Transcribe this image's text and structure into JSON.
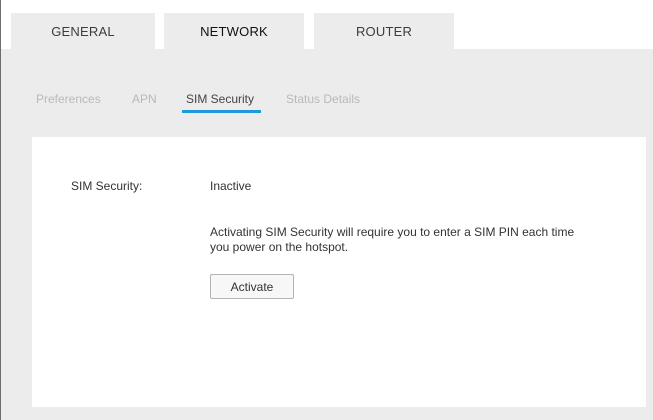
{
  "top_tabs": [
    {
      "label": "GENERAL",
      "active": false
    },
    {
      "label": "NETWORK",
      "active": true
    },
    {
      "label": "ROUTER",
      "active": false
    }
  ],
  "sub_tabs": [
    {
      "label": "Preferences",
      "active": false
    },
    {
      "label": "APN",
      "active": false
    },
    {
      "label": "SIM Security",
      "active": true
    },
    {
      "label": "Status Details",
      "active": false
    }
  ],
  "sim_security": {
    "label": "SIM Security:",
    "status": "Inactive",
    "description": "Activating SIM Security will require you to enter a SIM PIN each time you power on the hotspot.",
    "activate_label": "Activate"
  },
  "colors": {
    "accent": "#1e9ad6",
    "page_background": "#ececec",
    "panel_background": "#ffffff",
    "inactive_text": "#b9b9b9"
  }
}
